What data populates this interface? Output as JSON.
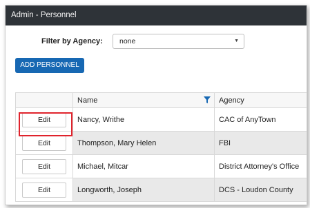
{
  "window": {
    "title": "Admin - Personnel"
  },
  "filter": {
    "label": "Filter by Agency:",
    "selected": "none"
  },
  "toolbar": {
    "add_label": "ADD PERSONNEL"
  },
  "table": {
    "headers": {
      "action": "",
      "name": "Name",
      "agency": "Agency"
    },
    "rows": [
      {
        "action": "Edit",
        "name": "Nancy, Writhe",
        "agency": "CAC of AnyTown"
      },
      {
        "action": "Edit",
        "name": "Thompson, Mary Helen",
        "agency": "FBI"
      },
      {
        "action": "Edit",
        "name": "Michael, Mitcar",
        "agency": "District Attorney's Office"
      },
      {
        "action": "Edit",
        "name": "Longworth, Joseph",
        "agency": "DCS - Loudon County"
      }
    ]
  },
  "colors": {
    "titlebar": "#2e3338",
    "primary": "#1768b3",
    "highlight": "#e0232c",
    "filter_icon": "#1768b3"
  }
}
